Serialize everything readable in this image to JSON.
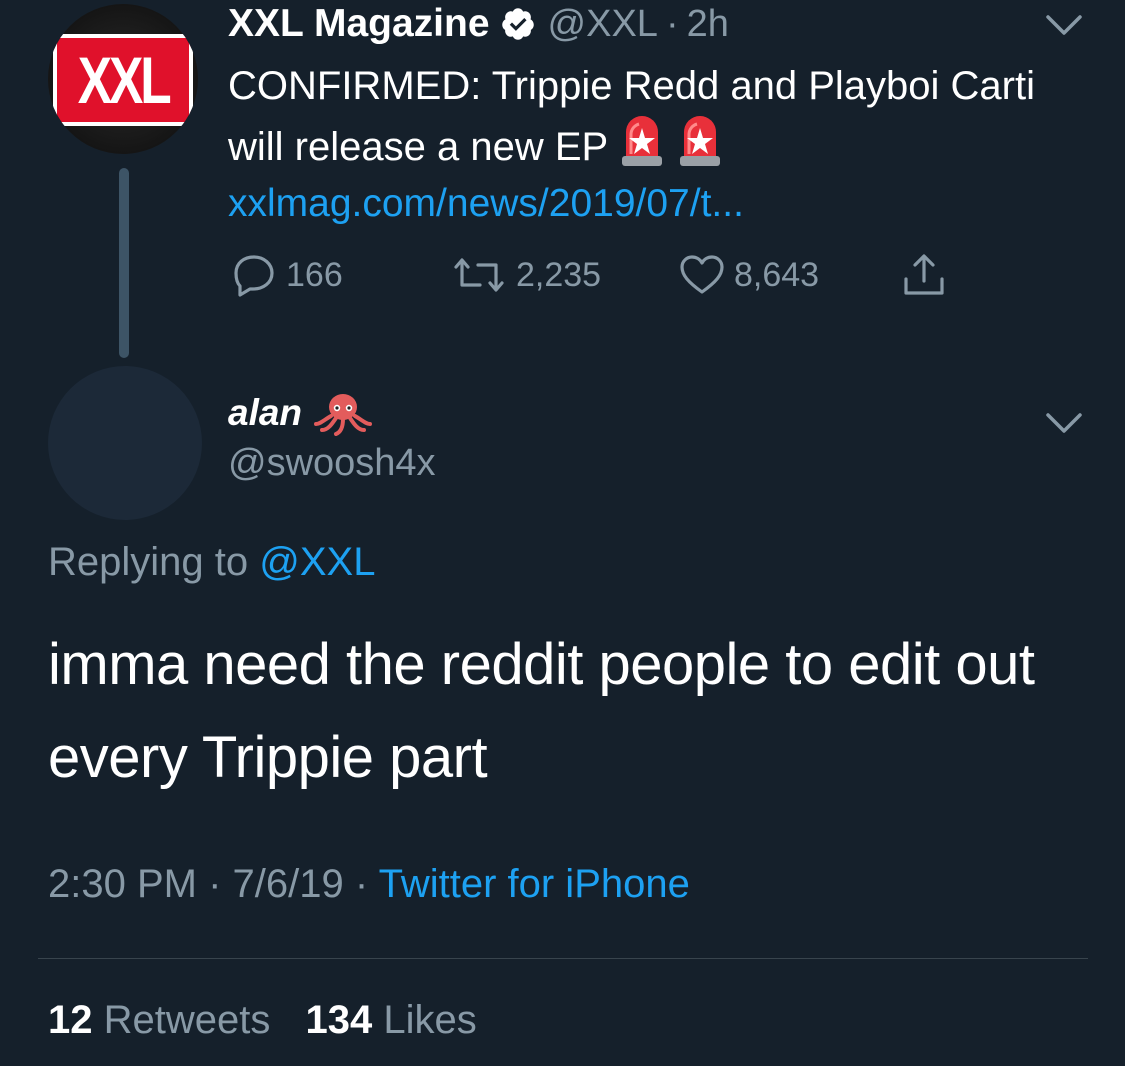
{
  "parent_tweet": {
    "avatar_logo_text": "XXL",
    "display_name": "XXL Magazine",
    "verified": true,
    "handle": "@XXL",
    "separator": "·",
    "time": "2h",
    "text": "CONFIRMED: Trippie Redd and Playboi Carti will release a new EP",
    "emojis": [
      "police-car-light-icon",
      "police-car-light-icon"
    ],
    "link": "xxlmag.com/news/2019/07/t...",
    "replies": "166",
    "retweets": "2,235",
    "likes": "8,643"
  },
  "reply_tweet": {
    "display_name": "alan",
    "name_emoji": "octopus-icon",
    "handle": "@swoosh4x",
    "replying_prefix": "Replying to",
    "replying_handle": "@XXL",
    "text": "imma need the reddit people to edit out every Trippie part",
    "time": "2:30 PM",
    "date": "7/6/19",
    "dot": "·",
    "source": "Twitter for iPhone",
    "retweet_count": "12",
    "retweet_label": "Retweets",
    "like_count": "134",
    "like_label": "Likes"
  },
  "colors": {
    "background": "#15202b",
    "text": "#ffffff",
    "muted": "#8899a6",
    "link": "#1da1f2",
    "divider": "#38444d"
  }
}
